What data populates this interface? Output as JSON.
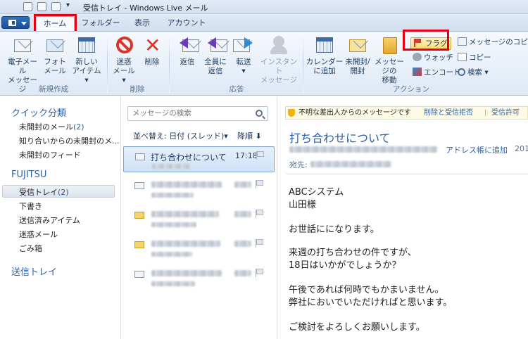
{
  "window": {
    "title": "受信トレイ - Windows Live メール"
  },
  "tabs": [
    {
      "label": "ホーム"
    },
    {
      "label": "フォルダー"
    },
    {
      "label": "表示"
    },
    {
      "label": "アカウント"
    }
  ],
  "ribbon": {
    "new_group": {
      "label": "新規作成",
      "email": [
        "電子メール",
        "メッセージ"
      ],
      "photo": [
        "フォト",
        "メール"
      ],
      "items": [
        "新しい",
        "アイテム ▾"
      ]
    },
    "delete_group": {
      "label": "削除",
      "junk": [
        "迷惑",
        "メール ▾"
      ],
      "delete": "削除"
    },
    "respond_group": {
      "label": "応答",
      "reply": "返信",
      "reply_all": [
        "全員に",
        "返信"
      ],
      "forward": [
        "転送",
        "▾"
      ],
      "im": [
        "インスタント",
        "メッセージ"
      ]
    },
    "actions_group": {
      "label": "アクション",
      "add_calendar": [
        "カレンダー",
        "に追加"
      ],
      "unread": [
        "未開封/",
        "開封"
      ],
      "move": [
        "メッセージの",
        "移動"
      ],
      "flag": "フラグ",
      "watch": "ウォッチ",
      "encode": "エンコード",
      "copy_message": "メッセージのコピー",
      "copy": "コピー",
      "find": "検索 ▾"
    }
  },
  "nav": {
    "quick_views_header": "クイック分類",
    "quick_views": [
      {
        "label": "未開封のメール",
        "count": "(2)"
      },
      {
        "label": "知り合いからの未開封のメ...",
        "count": ""
      },
      {
        "label": "未開封のフィード",
        "count": ""
      }
    ],
    "account_header": "FUJITSU",
    "folders": [
      {
        "label": "受信トレイ",
        "count": "(2)"
      },
      {
        "label": "下書き",
        "count": ""
      },
      {
        "label": "送信済みアイテム",
        "count": ""
      },
      {
        "label": "迷惑メール",
        "count": ""
      },
      {
        "label": "ごみ箱",
        "count": ""
      }
    ],
    "outbox_header": "送信トレイ"
  },
  "message_list": {
    "search_placeholder": "メッセージの検索",
    "sort_label": "並べ替え: 日付 (スレッド)▾",
    "sort_order": "降順 ⬇",
    "selected": {
      "subject": "打ち合わせについて",
      "time": "17:18"
    }
  },
  "reading_pane": {
    "infobar_text": "不明な差出人からのメッセージです",
    "infobar_link1": "削除と受信拒否",
    "infobar_sep": "|",
    "infobar_link2": "受信許可",
    "subject": "打ち合わせについて",
    "add_contact_link": "アドレス帳に追加",
    "date": "201",
    "to_label": "宛先:",
    "body": [
      "ABCシステム",
      "山田様",
      "",
      "お世話にになります。",
      "",
      "来週の打ち合わせの件ですが、",
      "18日はいかがでしょうか？",
      "",
      "午後であれば何時でもかまいません。",
      "弊社においでいただければと思います。",
      "",
      "ご検討をよろしくお願いします。"
    ]
  },
  "colors": {
    "highlight_box": "#e60012",
    "accent": "#2b5fa7"
  }
}
